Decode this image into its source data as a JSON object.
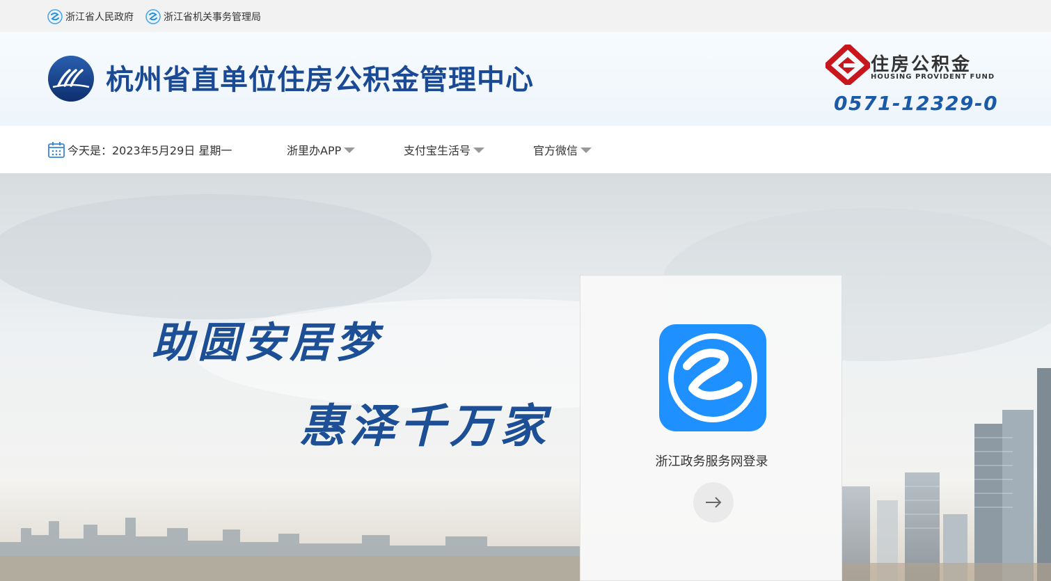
{
  "top_links": [
    {
      "label": "浙江省人民政府",
      "icon": "zhejiang-gov-icon"
    },
    {
      "label": "浙江省机关事务管理局",
      "icon": "zhejiang-gov-icon"
    }
  ],
  "header": {
    "title": "杭州省直单位住房公积金管理中心",
    "hpf_cn": "住房公积金",
    "hpf_en": "HOUSING PROVIDENT FUND",
    "hotline": "0571-12329-0",
    "colors": {
      "title": "#1b4a95",
      "hotline": "#1b5aa6",
      "brand_red": "#c8161d"
    }
  },
  "nav": {
    "date_text": "今天是：2023年5月29日 星期一",
    "items": [
      {
        "label": "浙里办APP"
      },
      {
        "label": "支付宝生活号"
      },
      {
        "label": "官方微信"
      }
    ]
  },
  "banner": {
    "slogan_line1": "助圆安居梦",
    "slogan_line2": "惠泽千万家"
  },
  "login": {
    "label": "浙江政务服务网登录",
    "app_icon": "zhejiang-service-app-icon",
    "button_icon": "arrow-right-icon",
    "accent": "#1e90ff"
  }
}
